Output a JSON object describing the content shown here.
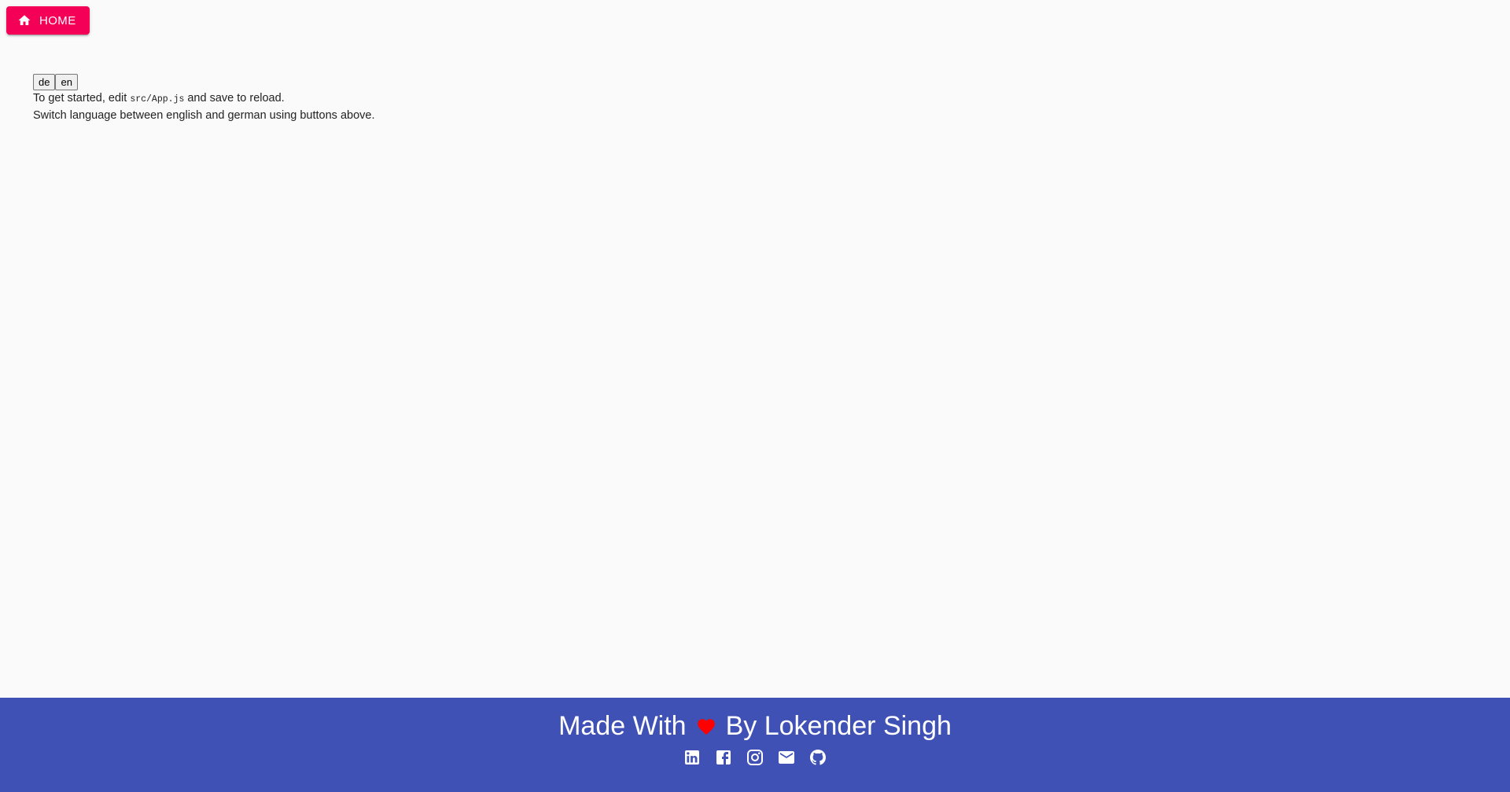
{
  "header": {
    "home_label": "HOME"
  },
  "content": {
    "lang_buttons": [
      "de",
      "en"
    ],
    "line1_prefix": "To get started, edit ",
    "line1_code": "src/App.js",
    "line1_suffix": " and save to reload.",
    "line2": "Switch language between english and german using buttons above."
  },
  "footer": {
    "made_with": "Made With",
    "by_author": "By Lokender Singh",
    "social_icons": [
      "linkedin-icon",
      "facebook-icon",
      "instagram-icon",
      "email-icon",
      "github-icon"
    ]
  },
  "colors": {
    "accent": "#f50057",
    "footer_bg": "#3f51b5",
    "heart": "#ff0000",
    "page_bg": "#fafafa"
  }
}
